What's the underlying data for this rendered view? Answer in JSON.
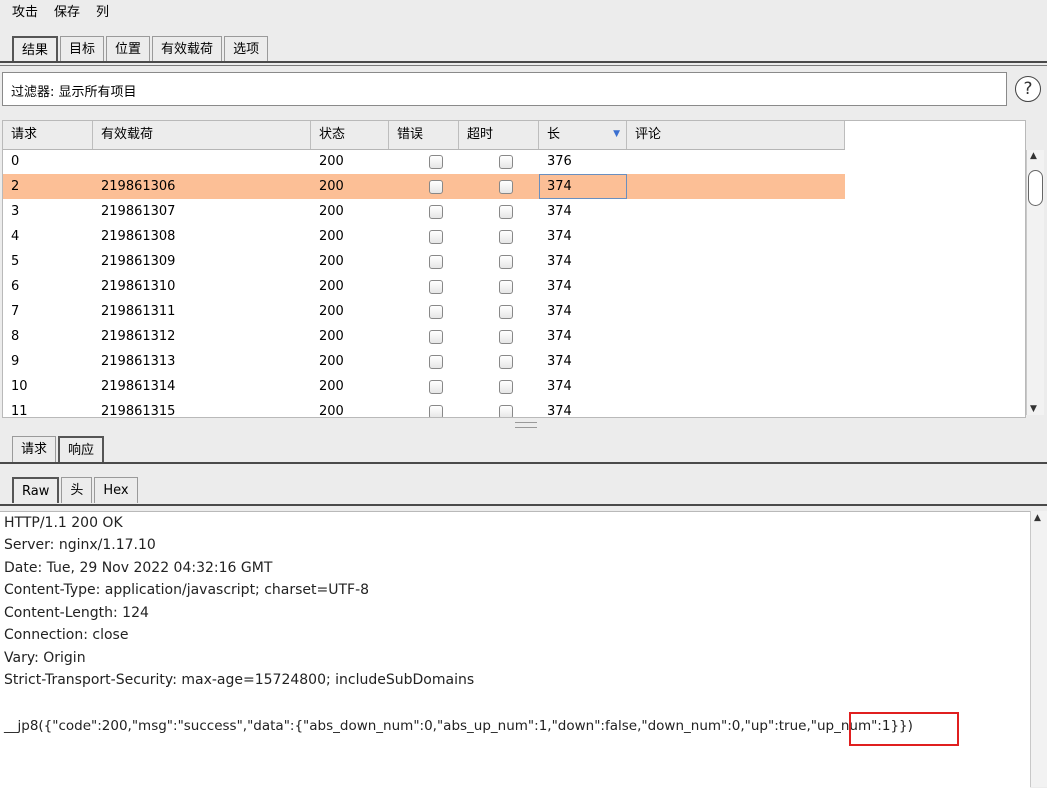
{
  "menu": [
    "攻击",
    "保存",
    "列"
  ],
  "main_tabs": [
    "结果",
    "目标",
    "位置",
    "有效载荷",
    "选项"
  ],
  "filter": {
    "text": "过滤器: 显示所有项目"
  },
  "help_label": "?",
  "table": {
    "headers": [
      "请求",
      "有效载荷",
      "状态",
      "错误",
      "超时",
      "长",
      "评论"
    ],
    "sort_arrow": "▼",
    "rows": [
      {
        "req": "0",
        "payload": "",
        "status": "200",
        "length": "376"
      },
      {
        "req": "2",
        "payload": "219861306",
        "status": "200",
        "length": "374",
        "selected": true
      },
      {
        "req": "3",
        "payload": "219861307",
        "status": "200",
        "length": "374"
      },
      {
        "req": "4",
        "payload": "219861308",
        "status": "200",
        "length": "374"
      },
      {
        "req": "5",
        "payload": "219861309",
        "status": "200",
        "length": "374"
      },
      {
        "req": "6",
        "payload": "219861310",
        "status": "200",
        "length": "374"
      },
      {
        "req": "7",
        "payload": "219861311",
        "status": "200",
        "length": "374"
      },
      {
        "req": "8",
        "payload": "219861312",
        "status": "200",
        "length": "374"
      },
      {
        "req": "9",
        "payload": "219861313",
        "status": "200",
        "length": "374"
      },
      {
        "req": "10",
        "payload": "219861314",
        "status": "200",
        "length": "374"
      },
      {
        "req": "11",
        "payload": "219861315",
        "status": "200",
        "length": "374"
      }
    ]
  },
  "detail_tabs": [
    "请求",
    "响应"
  ],
  "view_tabs": [
    "Raw",
    "头",
    "Hex"
  ],
  "response_lines": [
    "HTTP/1.1 200 OK",
    "Server: nginx/1.17.10",
    "Date: Tue, 29 Nov 2022 04:32:16 GMT",
    "Content-Type: application/javascript; charset=UTF-8",
    "Content-Length: 124",
    "Connection: close",
    "Vary: Origin",
    "Strict-Transport-Security: max-age=15724800; includeSubDomains",
    "",
    "__jp8({\"code\":200,\"msg\":\"success\",\"data\":{\"abs_down_num\":0,\"abs_up_num\":1,\"down\":false,\"down_num\":0,\"up\":true,\"up_num\":1}})"
  ],
  "colors": {
    "selected_row": "#fcbf96",
    "highlight_border": "#e01f1f",
    "sort_arrow": "#3a6fd0"
  }
}
